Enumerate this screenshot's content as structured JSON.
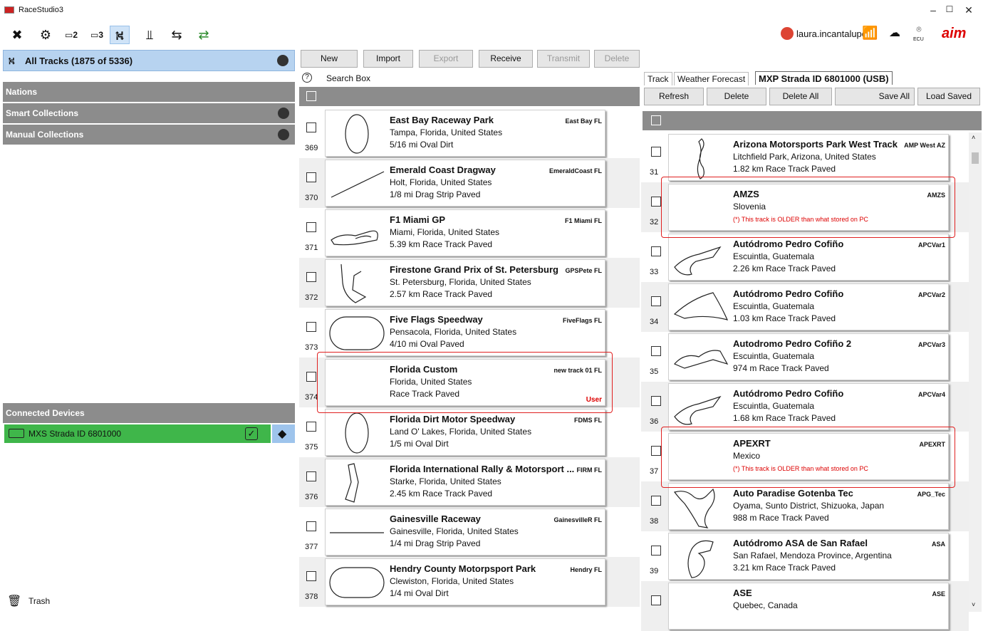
{
  "window": {
    "title": "RaceStudio3"
  },
  "toolbar": {
    "icons": [
      "tools-icon",
      "settings-gear-icon",
      "dash-v2-icon",
      "dash-v3-icon",
      "tracks-icon",
      "analysis-icon",
      "add-device-icon",
      "transfer-icon"
    ],
    "user": "laura.incantalupo",
    "ecu_label": "ECU",
    "brand": "aim"
  },
  "left": {
    "header": "All Tracks  (1875 of 5336)",
    "nations": "Nations",
    "smart": "Smart Collections",
    "manual": "Manual Collections",
    "connected": "Connected Devices",
    "device": "MXS Strada ID 6801000",
    "trash": "Trash"
  },
  "center": {
    "buttons": [
      "New",
      "Import",
      "Export",
      "Receive",
      "Transmit",
      "Delete"
    ],
    "search_help": "?",
    "search": "Search Box",
    "rows": [
      {
        "num": "369",
        "name": "East Bay Raceway Park",
        "code": "East Bay FL",
        "loc": "Tampa, Florida, United States",
        "info": "5/16 mi Oval Dirt",
        "user": ""
      },
      {
        "num": "370",
        "name": "Emerald Coast Dragway",
        "code": "EmeraldCoast FL",
        "loc": "Holt, Florida, United States",
        "info": "1/8 mi Drag Strip Paved",
        "user": ""
      },
      {
        "num": "371",
        "name": "F1 Miami GP",
        "code": "F1 Miami FL",
        "loc": "Miami, Florida, United States",
        "info": "5.39 km Race Track Paved",
        "user": ""
      },
      {
        "num": "372",
        "name": "Firestone Grand Prix of St. Petersburg",
        "code": "GPSPete FL",
        "loc": "St. Petersburg, Florida, United States",
        "info": "2.57 km Race Track Paved",
        "user": ""
      },
      {
        "num": "373",
        "name": "Five Flags Speedway",
        "code": "FiveFlags FL",
        "loc": "Pensacola, Florida, United States",
        "info": "4/10 mi Oval Paved",
        "user": ""
      },
      {
        "num": "374",
        "name": "Florida Custom",
        "code": "new track 01 FL",
        "loc": "Florida, United States",
        "info": " Race Track Paved",
        "user": "User"
      },
      {
        "num": "375",
        "name": "Florida Dirt Motor Speedway",
        "code": "FDMS FL",
        "loc": "Land O' Lakes, Florida, United States",
        "info": "1/5 mi Oval Dirt",
        "user": ""
      },
      {
        "num": "376",
        "name": "Florida International Rally & Motorsport ...",
        "code": "FIRM FL",
        "loc": "Starke, Florida, United States",
        "info": "2.45 km Race Track Paved",
        "user": ""
      },
      {
        "num": "377",
        "name": "Gainesville Raceway",
        "code": "GainesvilleR FL",
        "loc": "Gainesville, Florida, United States",
        "info": "1/4 mi Drag Strip Paved",
        "user": ""
      },
      {
        "num": "378",
        "name": "Hendry County Motorpsport Park",
        "code": "Hendry FL",
        "loc": "Clewiston, Florida, United States",
        "info": "1/4 mi Oval Dirt",
        "user": ""
      }
    ]
  },
  "right": {
    "tabs": [
      "Track",
      "Weather Forecast",
      "MXP Strada ID 6801000 (USB)"
    ],
    "buttons": [
      "Refresh",
      "Delete",
      "Delete All",
      "Save All",
      "Load Saved"
    ],
    "rows": [
      {
        "num": "31",
        "name": "Arizona Motorsports Park West Track",
        "code": "AMP West AZ",
        "loc": "Litchfield Park, Arizona, United States",
        "info": "1.82 km Race Track Paved",
        "warn": ""
      },
      {
        "num": "32",
        "name": "AMZS",
        "code": "AMZS",
        "loc": "Slovenia",
        "info": "",
        "warn": "(*) This track is OLDER than what stored on PC"
      },
      {
        "num": "33",
        "name": "Autódromo Pedro Cofiño",
        "code": "APCVar1",
        "loc": "Escuintla, Guatemala",
        "info": "2.26 km Race Track Paved",
        "warn": ""
      },
      {
        "num": "34",
        "name": "Autódromo Pedro Cofiño",
        "code": "APCVar2",
        "loc": "Escuintla, Guatemala",
        "info": "1.03 km Race Track Paved",
        "warn": ""
      },
      {
        "num": "35",
        "name": "Autodromo Pedro Cofiño 2",
        "code": "APCVar3",
        "loc": "Escuintla, Guatemala",
        "info": "974 m Race Track Paved",
        "warn": ""
      },
      {
        "num": "36",
        "name": "Autódromo Pedro Cofiño",
        "code": "APCVar4",
        "loc": "Escuintla, Guatemala",
        "info": "1.68 km Race Track Paved",
        "warn": ""
      },
      {
        "num": "37",
        "name": "APEXRT",
        "code": "APEXRT",
        "loc": "Mexico",
        "info": "",
        "warn": "(*) This track is OLDER than what stored on PC"
      },
      {
        "num": "38",
        "name": "Auto Paradise Gotenba Tec",
        "code": "APG_Tec",
        "loc": "Oyama, Sunto District, Shizuoka, Japan",
        "info": "988 m Race Track Paved",
        "warn": ""
      },
      {
        "num": "39",
        "name": "Autódromo ASA de San Rafael",
        "code": "ASA",
        "loc": "San Rafael, Mendoza Province, Argentina",
        "info": "3.21 km Race Track Paved",
        "warn": ""
      },
      {
        "num": "",
        "name": "ASE",
        "code": "ASE",
        "loc": "Quebec, Canada",
        "info": "",
        "warn": ""
      }
    ]
  }
}
